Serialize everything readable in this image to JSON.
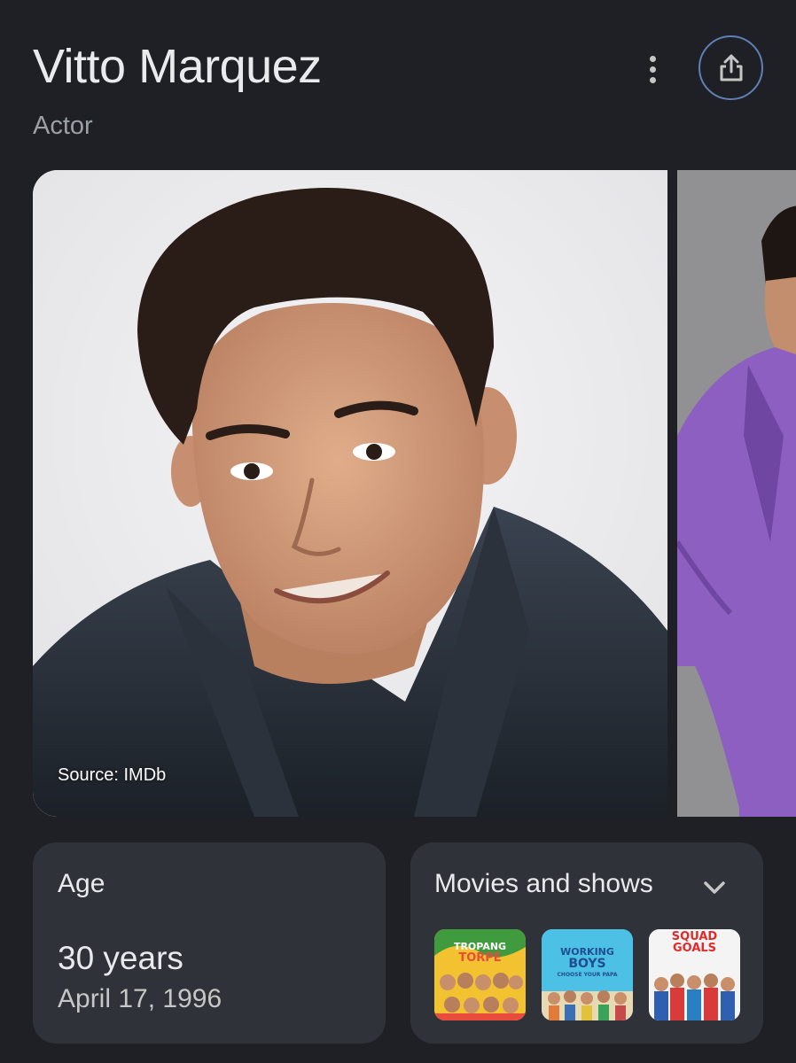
{
  "header": {
    "title": "Vitto Marquez",
    "subtitle": "Actor"
  },
  "gallery": {
    "source_label": "Source: IMDb"
  },
  "age_card": {
    "label": "Age",
    "value": "30 years",
    "birthdate": "April 17, 1996"
  },
  "movies_card": {
    "label": "Movies and shows",
    "items": [
      {
        "line1": "TROPANG",
        "line2": "TORPE"
      },
      {
        "line1": "WORKING",
        "line2": "BOYS",
        "line3": "CHOOSE YOUR PAPA"
      },
      {
        "line1": "SQUAD",
        "line2": "GOALS"
      }
    ]
  },
  "colors": {
    "background": "#1f2025",
    "card": "#30323a",
    "share_ring": "#5f7fb6"
  }
}
